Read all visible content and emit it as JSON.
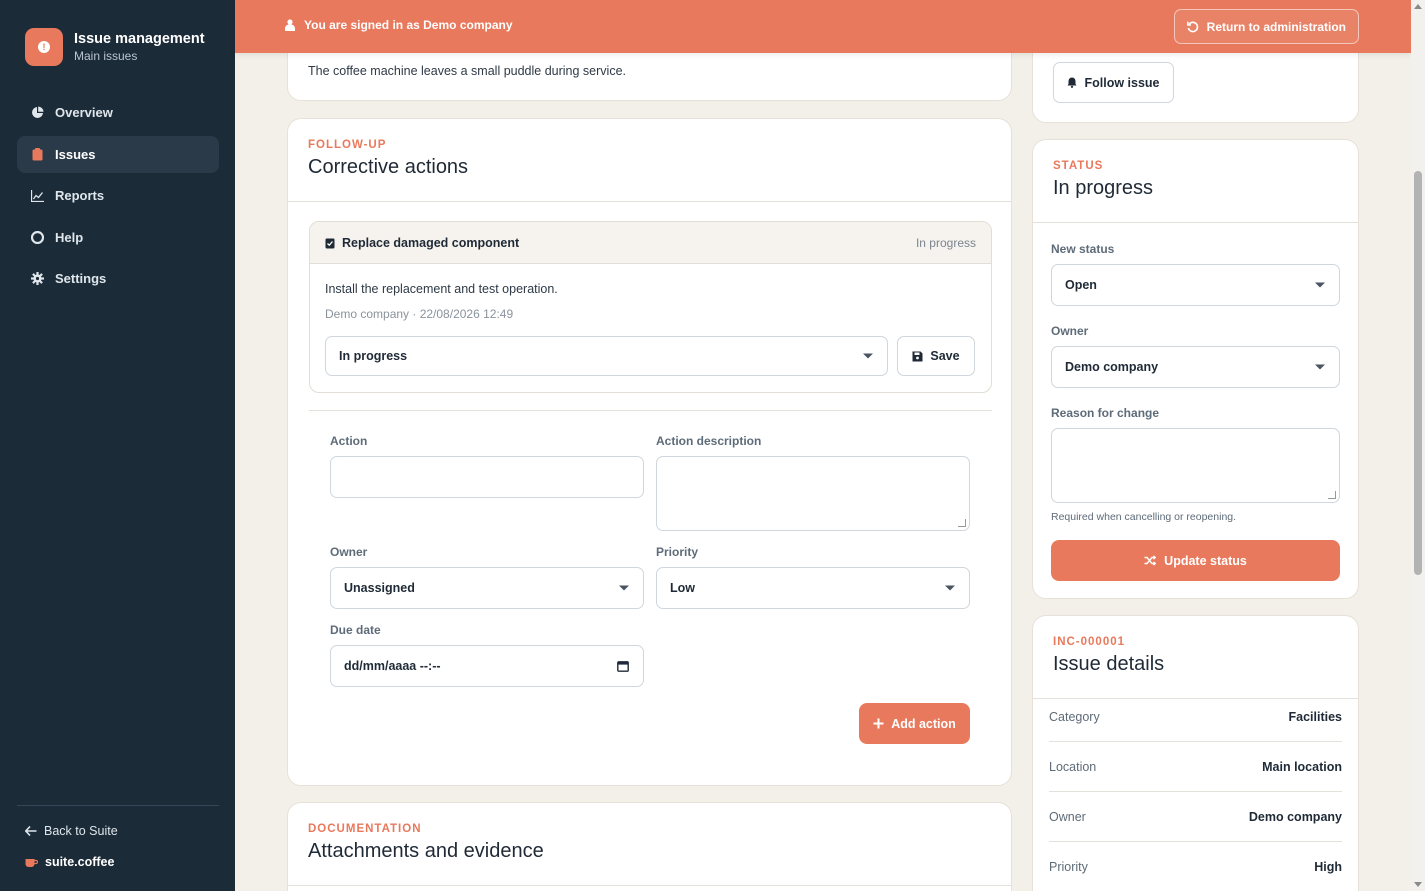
{
  "sidebar": {
    "brand_title": "Issue management",
    "brand_subtitle": "Main issues",
    "items": [
      {
        "label": "Overview"
      },
      {
        "label": "Issues"
      },
      {
        "label": "Reports"
      },
      {
        "label": "Help"
      },
      {
        "label": "Settings"
      }
    ],
    "back_label": "Back to Suite",
    "suite_label": "suite.coffee"
  },
  "banner": {
    "signed_in_text": "You are signed in as Demo company",
    "return_label": "Return to administration"
  },
  "description_card": {
    "text": "The coffee machine leaves a small puddle during service."
  },
  "followup": {
    "section_label": "FOLLOW-UP",
    "title": "Corrective actions",
    "action_item": {
      "title": "Replace damaged component",
      "status": "In progress",
      "description": "Install the replacement and test operation.",
      "meta": "Demo company · 22/08/2026 12:49",
      "status_select": "In progress",
      "save_label": "Save"
    },
    "form": {
      "action_label": "Action",
      "action_value": "",
      "action_description_label": "Action description",
      "action_description_value": "",
      "owner_label": "Owner",
      "owner_value": "Unassigned",
      "priority_label": "Priority",
      "priority_value": "Low",
      "due_date_label": "Due date",
      "due_date_value": "dd/mm/aaaa --:--",
      "add_label": "Add action"
    }
  },
  "documentation": {
    "section_label": "DOCUMENTATION",
    "title": "Attachments and evidence"
  },
  "follow_card": {
    "follow_label": "Follow issue"
  },
  "status_card": {
    "section_label": "STATUS",
    "title": "In progress",
    "new_status_label": "New status",
    "new_status_value": "Open",
    "owner_label": "Owner",
    "owner_value": "Demo company",
    "reason_label": "Reason for change",
    "reason_value": "",
    "hint": "Required when cancelling or reopening.",
    "update_label": "Update status"
  },
  "details_card": {
    "section_label": "INC-000001",
    "title": "Issue details",
    "rows": [
      {
        "key": "Category",
        "value": "Facilities"
      },
      {
        "key": "Location",
        "value": "Main location"
      },
      {
        "key": "Owner",
        "value": "Demo company"
      },
      {
        "key": "Priority",
        "value": "High"
      }
    ]
  },
  "colors": {
    "accent": "#e8795c",
    "sidebar": "#1c2b38",
    "background": "#f3efe9"
  },
  "icons": [
    "alert-icon",
    "pie-chart-icon",
    "clipboard-icon",
    "bar-chart-icon",
    "lifebuoy-icon",
    "gear-icon",
    "arrow-left-icon",
    "coffee-icon",
    "user-icon",
    "undo-icon",
    "bell-icon",
    "check-clipboard-icon",
    "save-icon",
    "plus-icon",
    "shuffle-icon"
  ]
}
